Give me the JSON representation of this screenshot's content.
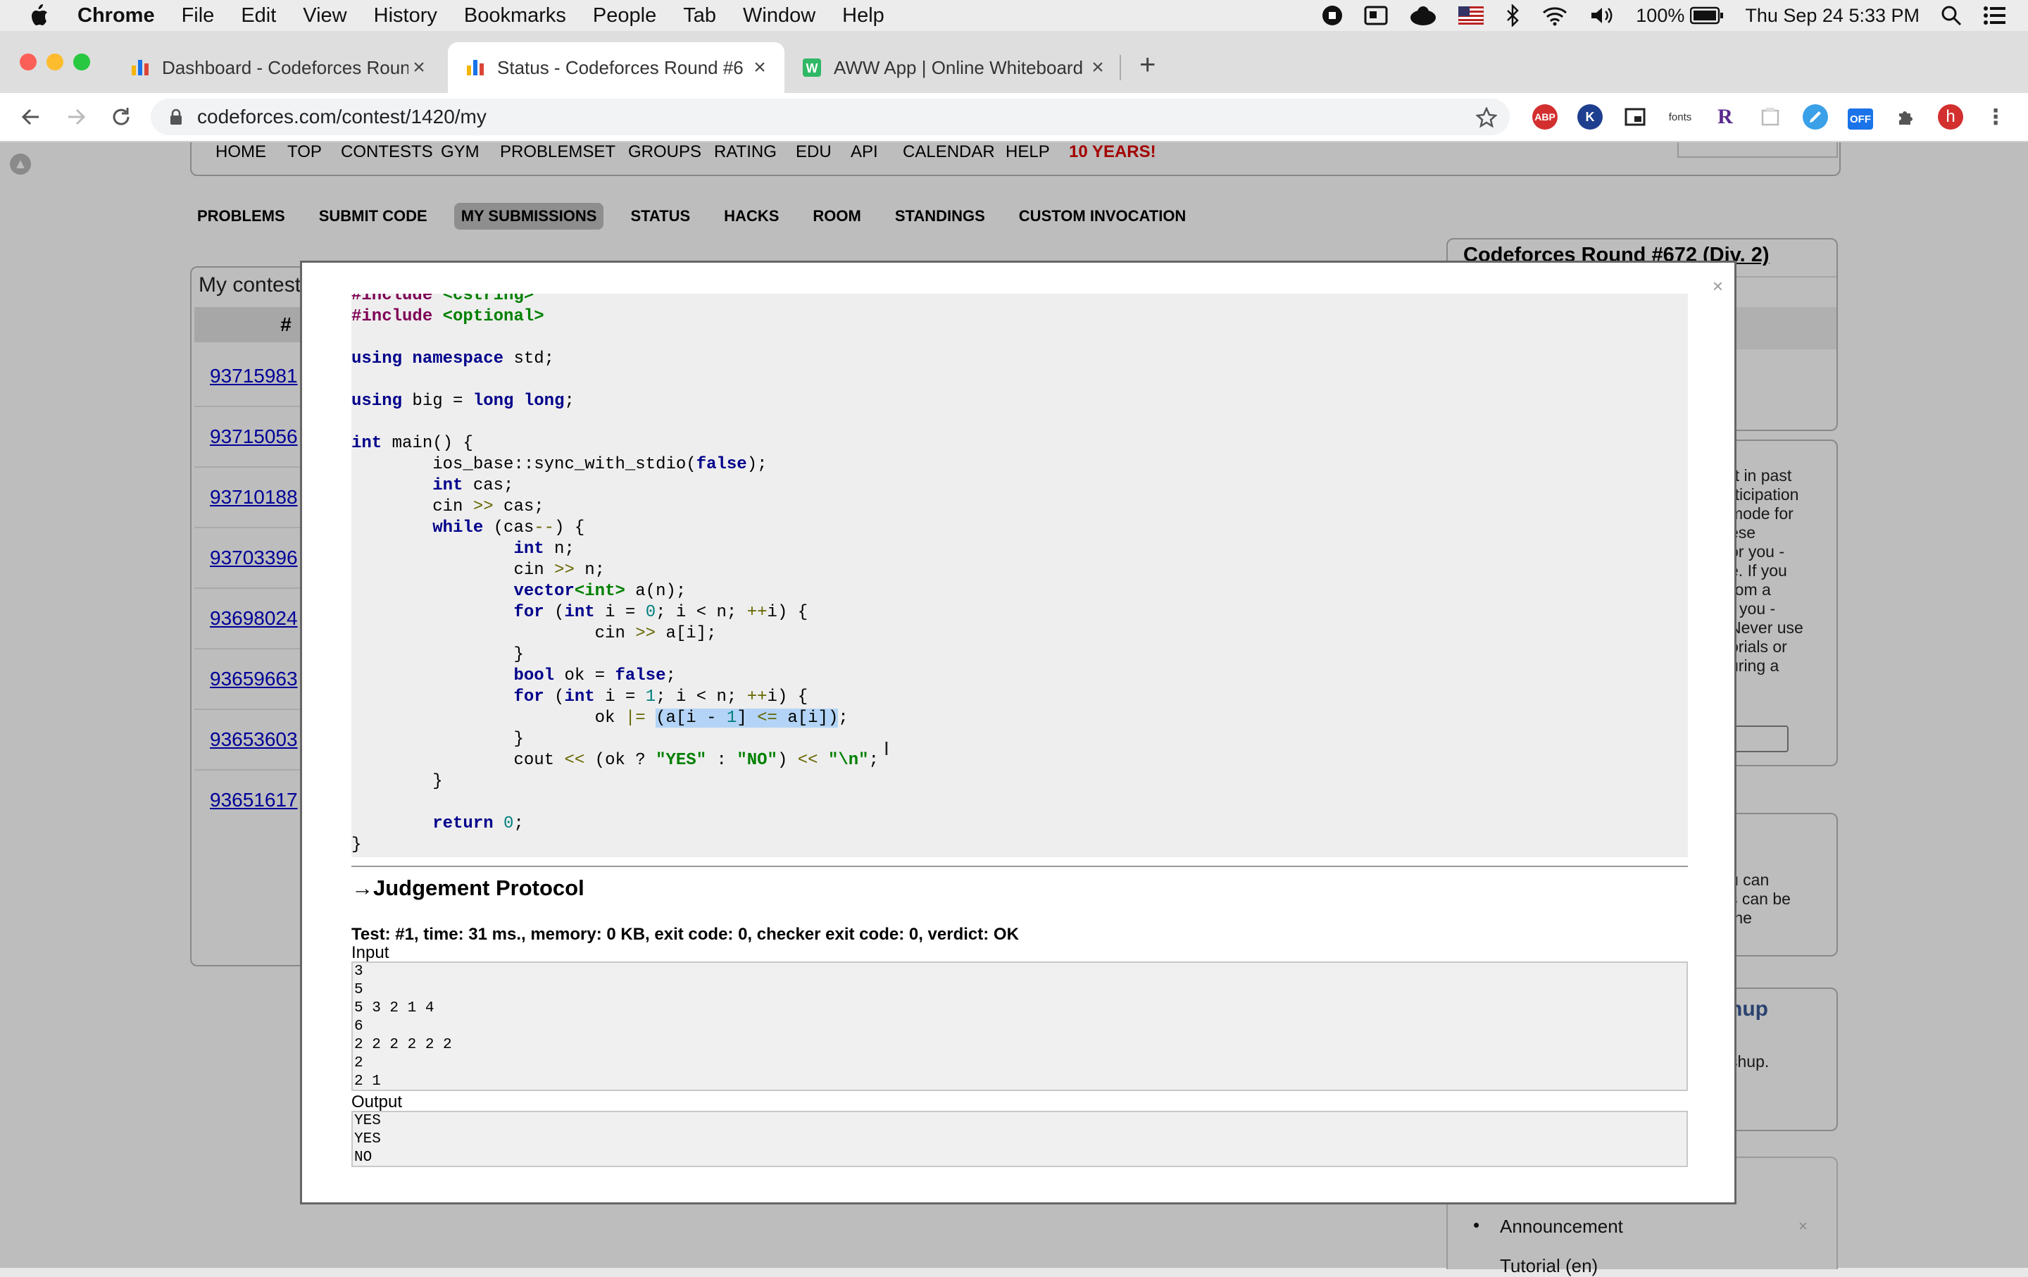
{
  "menubar": {
    "app": "Chrome",
    "items": [
      "File",
      "Edit",
      "View",
      "History",
      "Bookmarks",
      "People",
      "Tab",
      "Window",
      "Help"
    ],
    "battery": "100%",
    "datetime": "Thu Sep 24  5:33 PM"
  },
  "tabs": [
    {
      "title": "Dashboard - Codeforces Round",
      "favicon": "codeforces-bars",
      "active": false
    },
    {
      "title": "Status - Codeforces Round #6",
      "favicon": "codeforces-bars",
      "active": true
    },
    {
      "title": "AWW App | Online Whiteboard",
      "favicon": "aww-w",
      "active": false
    }
  ],
  "omnibox": {
    "url": "codeforces.com/contest/1420/my"
  },
  "extensions": [
    "ABP",
    "K",
    "fonts",
    "R",
    "OFF",
    "h"
  ],
  "topnav": [
    "HOME",
    "TOP",
    "CONTESTS",
    "GYM",
    "PROBLEMSET",
    "GROUPS",
    "RATING",
    "EDU",
    "API",
    "CALENDAR",
    "HELP",
    "10 YEARS!"
  ],
  "subnav": [
    {
      "label": "PROBLEMS",
      "active": false
    },
    {
      "label": "SUBMIT CODE",
      "active": false
    },
    {
      "label": "MY SUBMISSIONS",
      "active": true
    },
    {
      "label": "STATUS",
      "active": false
    },
    {
      "label": "HACKS",
      "active": false
    },
    {
      "label": "ROOM",
      "active": false
    },
    {
      "label": "STANDINGS",
      "active": false
    },
    {
      "label": "CUSTOM INVOCATION",
      "active": false
    }
  ],
  "left_panel": {
    "title": "My contest",
    "col": "#",
    "submissions": [
      "93715981",
      "93715056",
      "93710188",
      "93703396",
      "93698024",
      "93659663",
      "93653603",
      "93651617"
    ]
  },
  "right_panel": {
    "title": "Codeforces Round #672 (Div. 2)",
    "text1": [
      "rt in past",
      "rticipation",
      "mode for",
      "ese",
      "or you -",
      "e. If you",
      "rom a",
      "r you -",
      "Never use",
      "orials or",
      "uring a"
    ],
    "text2": [
      "u can",
      "s can be",
      "the"
    ],
    "mashup_title": "hup",
    "mashup_text": "shup.",
    "announcement": "Announcement",
    "tutorial": "Tutorial (en)"
  },
  "modal": {
    "close": "×",
    "code_lines": [
      "#include <cstring>",
      "#include <optional>",
      "",
      "using namespace std;",
      "",
      "using big = long long;",
      "",
      "int main() {",
      "        ios_base::sync_with_stdio(false);",
      "        int cas;",
      "        cin >> cas;",
      "        while (cas--) {",
      "                int n;",
      "                cin >> n;",
      "                vector<int> a(n);",
      "                for (int i = 0; i < n; ++i) {",
      "                        cin >> a[i];",
      "                }",
      "                bool ok = false;",
      "                for (int i = 1; i < n; ++i) {",
      "                        ok |= (a[i - 1] <= a[i]);",
      "                }",
      "                cout << (ok ? \"YES\" : \"NO\") << \"\\n\";",
      "        }",
      "",
      "        return 0;",
      "}"
    ],
    "protocol_title": "→Judgement Protocol",
    "test_line": "Test: #1, time: 31 ms., memory: 0 KB, exit code: 0, checker exit code: 0, verdict: OK",
    "input_label": "Input",
    "input_lines": [
      "3",
      "5",
      "5 3 2 1 4",
      "6",
      "2 2 2 2 2 2",
      "2",
      "2 1"
    ],
    "output_label": "Output",
    "output_lines": [
      "YES",
      "YES",
      "NO"
    ]
  },
  "colors": {
    "link": "#0000cc",
    "keyword": "#00008b",
    "string": "#008000",
    "selection": "#b3d4f6"
  }
}
